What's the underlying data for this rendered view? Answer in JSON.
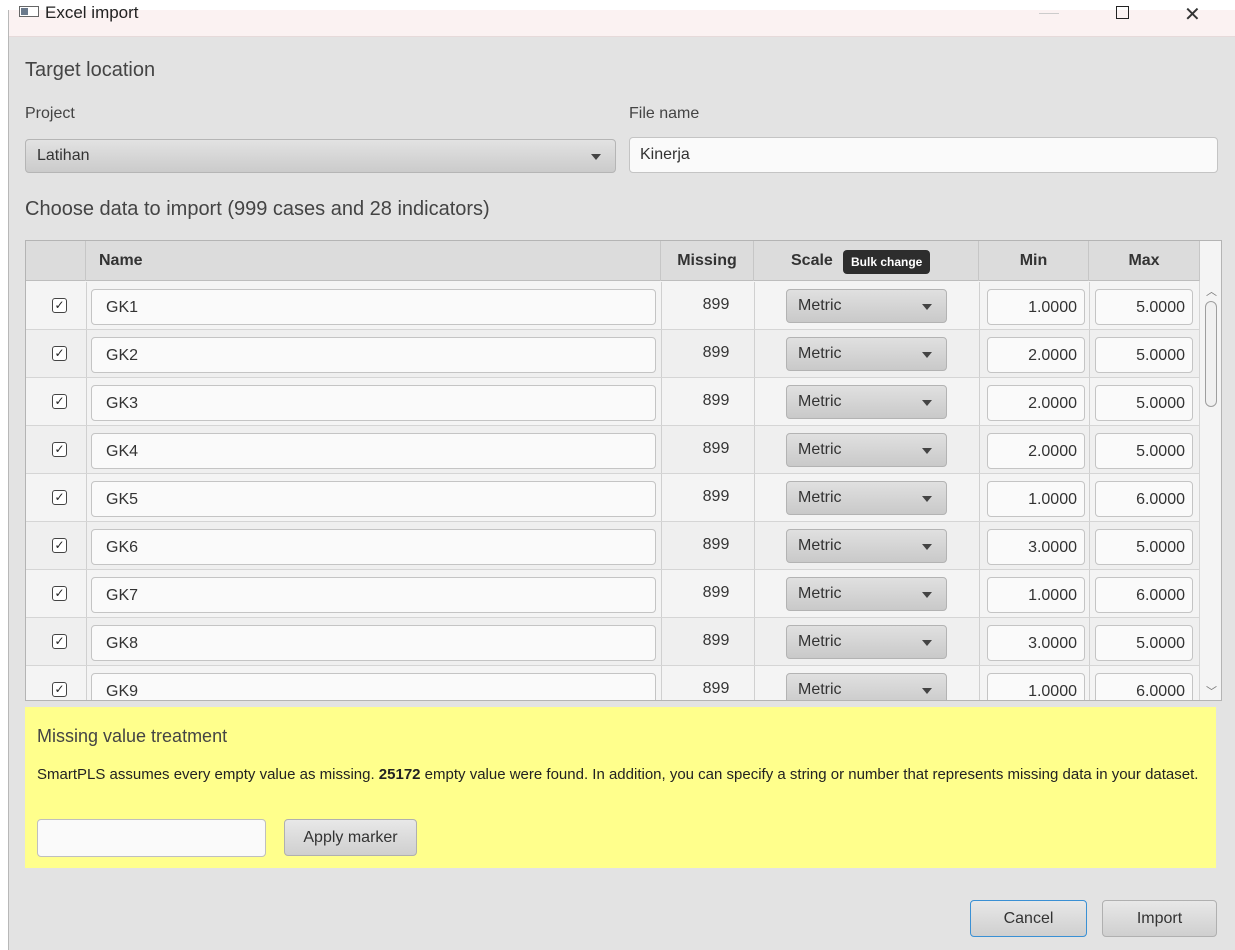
{
  "window": {
    "title": "Excel import",
    "controls": {
      "minimize": "—",
      "maximize": "",
      "close": "✕"
    }
  },
  "target": {
    "heading": "Target location",
    "project_label": "Project",
    "project_value": "Latihan",
    "file_label": "File name",
    "file_value": "Kinerja"
  },
  "data_section": {
    "heading": "Choose data to import (999 cases and 28 indicators)"
  },
  "table": {
    "columns": {
      "name": "Name",
      "missing": "Missing",
      "scale": "Scale",
      "min": "Min",
      "max": "Max"
    },
    "bulk_change": "Bulk change",
    "checkmark": "✓",
    "rows": [
      {
        "checked": true,
        "name": "GK1",
        "missing": "899",
        "scale": "Metric",
        "min": "1.0000",
        "max": "5.0000"
      },
      {
        "checked": true,
        "name": "GK2",
        "missing": "899",
        "scale": "Metric",
        "min": "2.0000",
        "max": "5.0000"
      },
      {
        "checked": true,
        "name": "GK3",
        "missing": "899",
        "scale": "Metric",
        "min": "2.0000",
        "max": "5.0000"
      },
      {
        "checked": true,
        "name": "GK4",
        "missing": "899",
        "scale": "Metric",
        "min": "2.0000",
        "max": "5.0000"
      },
      {
        "checked": true,
        "name": "GK5",
        "missing": "899",
        "scale": "Metric",
        "min": "1.0000",
        "max": "6.0000"
      },
      {
        "checked": true,
        "name": "GK6",
        "missing": "899",
        "scale": "Metric",
        "min": "3.0000",
        "max": "5.0000"
      },
      {
        "checked": true,
        "name": "GK7",
        "missing": "899",
        "scale": "Metric",
        "min": "1.0000",
        "max": "6.0000"
      },
      {
        "checked": true,
        "name": "GK8",
        "missing": "899",
        "scale": "Metric",
        "min": "3.0000",
        "max": "5.0000"
      },
      {
        "checked": true,
        "name": "GK9",
        "missing": "899",
        "scale": "Metric",
        "min": "1.0000",
        "max": "6.0000"
      }
    ]
  },
  "missing_treatment": {
    "heading": "Missing value treatment",
    "text_before": "SmartPLS assumes every empty value as missing. ",
    "count": "25172",
    "text_after": " empty value were found. In addition, you can specify a string or number that represents missing data in your dataset.",
    "marker_value": "",
    "apply_label": "Apply marker"
  },
  "footer": {
    "cancel_label": "Cancel",
    "import_label": "Import"
  }
}
